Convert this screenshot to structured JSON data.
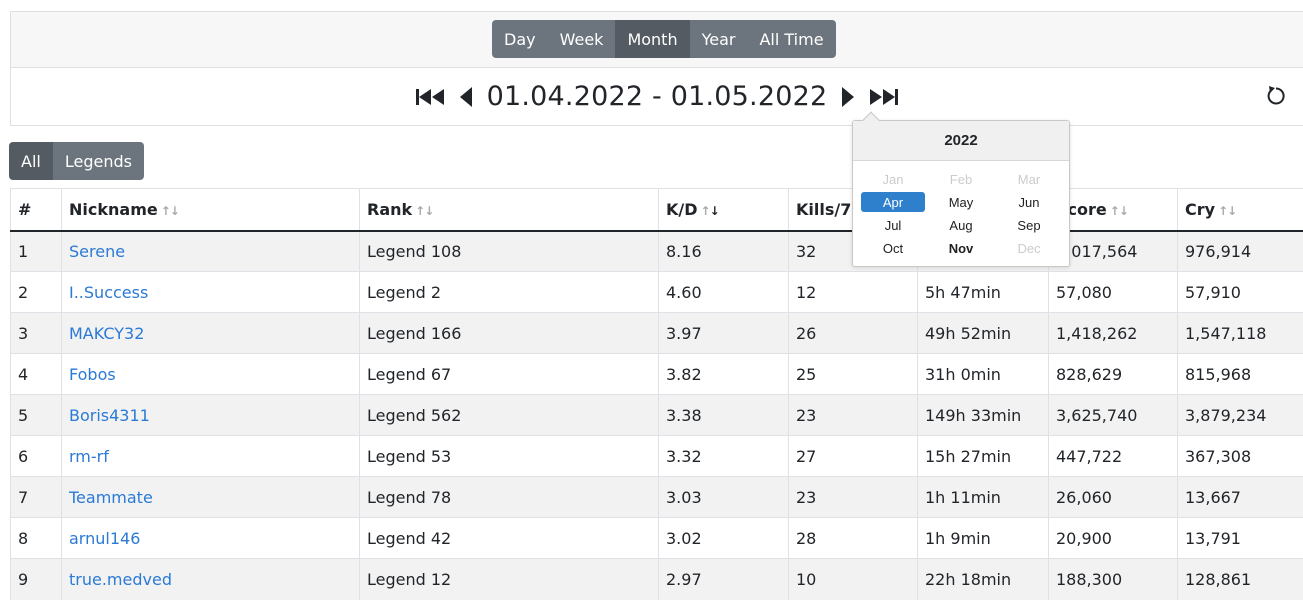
{
  "period_tabs": [
    {
      "label": "Day",
      "active": false
    },
    {
      "label": "Week",
      "active": false
    },
    {
      "label": "Month",
      "active": true
    },
    {
      "label": "Year",
      "active": false
    },
    {
      "label": "All Time",
      "active": false
    }
  ],
  "date_nav": {
    "range": "01.04.2022 - 01.05.2022",
    "icons": [
      "first-page-icon",
      "prev-icon",
      "next-icon",
      "last-page-icon",
      "reset-icon"
    ]
  },
  "league_tabs": [
    {
      "label": "All",
      "active": true
    },
    {
      "label": "Legends",
      "active": false
    }
  ],
  "table": {
    "columns": [
      {
        "label": "#",
        "sortable": false
      },
      {
        "label": "Nickname",
        "sortable": true
      },
      {
        "label": "Rank",
        "sortable": true
      },
      {
        "label": "K/D",
        "sortable": true,
        "sorted": "desc"
      },
      {
        "label": "Kills/7m",
        "sortable": true
      },
      {
        "label": "Time",
        "sortable": true
      },
      {
        "label": "Score",
        "sortable": true
      },
      {
        "label": "Cry",
        "sortable": true
      }
    ],
    "rows": [
      {
        "num": "1",
        "nickname": "Serene",
        "rank": "Legend 108",
        "kd": "8.16",
        "kills": "32",
        "time": "",
        "score": "1,017,564",
        "cry": "976,914"
      },
      {
        "num": "2",
        "nickname": "I..Success",
        "rank": "Legend 2",
        "kd": "4.60",
        "kills": "12",
        "time": "5h 47min",
        "score": "57,080",
        "cry": "57,910"
      },
      {
        "num": "3",
        "nickname": "MAKCY32",
        "rank": "Legend 166",
        "kd": "3.97",
        "kills": "26",
        "time": "49h 52min",
        "score": "1,418,262",
        "cry": "1,547,118"
      },
      {
        "num": "4",
        "nickname": "Fobos",
        "rank": "Legend 67",
        "kd": "3.82",
        "kills": "25",
        "time": "31h 0min",
        "score": "828,629",
        "cry": "815,968"
      },
      {
        "num": "5",
        "nickname": "Boris4311",
        "rank": "Legend 562",
        "kd": "3.38",
        "kills": "23",
        "time": "149h 33min",
        "score": "3,625,740",
        "cry": "3,879,234"
      },
      {
        "num": "6",
        "nickname": "rm-rf",
        "rank": "Legend 53",
        "kd": "3.32",
        "kills": "27",
        "time": "15h 27min",
        "score": "447,722",
        "cry": "367,308"
      },
      {
        "num": "7",
        "nickname": "Teammate",
        "rank": "Legend 78",
        "kd": "3.03",
        "kills": "23",
        "time": "1h 11min",
        "score": "26,060",
        "cry": "13,667"
      },
      {
        "num": "8",
        "nickname": "arnul146",
        "rank": "Legend 42",
        "kd": "3.02",
        "kills": "28",
        "time": "1h 9min",
        "score": "20,900",
        "cry": "13,791"
      },
      {
        "num": "9",
        "nickname": "true.medved",
        "rank": "Legend 12",
        "kd": "2.97",
        "kills": "10",
        "time": "22h 18min",
        "score": "188,300",
        "cry": "128,861"
      }
    ]
  },
  "month_picker": {
    "year": "2022",
    "months": [
      {
        "label": "Jan",
        "state": "disabled"
      },
      {
        "label": "Feb",
        "state": "disabled"
      },
      {
        "label": "Mar",
        "state": "disabled"
      },
      {
        "label": "Apr",
        "state": "selected"
      },
      {
        "label": "May",
        "state": "normal"
      },
      {
        "label": "Jun",
        "state": "normal"
      },
      {
        "label": "Jul",
        "state": "normal"
      },
      {
        "label": "Aug",
        "state": "normal"
      },
      {
        "label": "Sep",
        "state": "normal"
      },
      {
        "label": "Oct",
        "state": "normal"
      },
      {
        "label": "Nov",
        "state": "current"
      },
      {
        "label": "Dec",
        "state": "disabled"
      }
    ],
    "colors": {
      "selected": "#2f80cc",
      "disabled": "#cccccc"
    }
  },
  "colors": {
    "button": "#6c757d",
    "button_active": "#545b62",
    "link": "#2a7ad6",
    "stripe": "#f2f2f2"
  }
}
